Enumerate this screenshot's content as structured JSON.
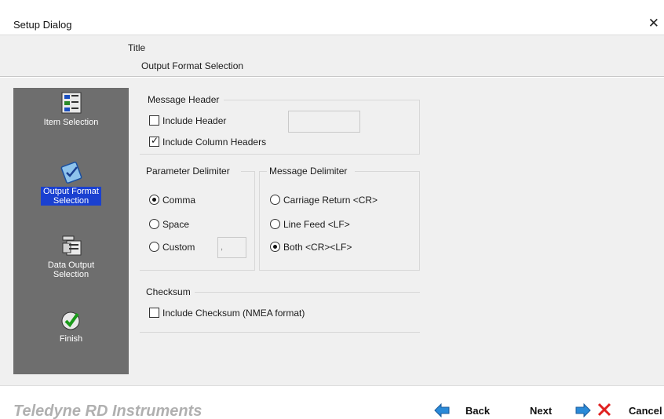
{
  "window": {
    "title": "Setup Dialog",
    "close_glyph": "✕"
  },
  "header": {
    "title": "Title",
    "subtitle": "Output Format Selection"
  },
  "sidebar": {
    "items": [
      {
        "label": "Item Selection",
        "icon": "item-selection-icon",
        "active": false
      },
      {
        "label": "Output Format\nSelection",
        "icon": "output-format-icon",
        "active": true
      },
      {
        "label": "Data Output\nSelection",
        "icon": "data-output-icon",
        "active": false
      },
      {
        "label": "Finish",
        "icon": "finish-icon",
        "active": false
      }
    ]
  },
  "message_header": {
    "legend": "Message Header",
    "include_header": {
      "label": "Include Header",
      "checked": false
    },
    "include_column_headers": {
      "label": "Include Column Headers",
      "checked": true
    },
    "header_text": ""
  },
  "parameter_delimiter": {
    "legend": "Parameter Delimiter",
    "options": [
      {
        "label": "Comma",
        "checked": true
      },
      {
        "label": "Space",
        "checked": false
      },
      {
        "label": "Custom",
        "checked": false
      }
    ],
    "custom_value": ","
  },
  "message_delimiter": {
    "legend": "Message Delimiter",
    "options": [
      {
        "label": "Carriage Return <CR>",
        "checked": false
      },
      {
        "label": "Line Feed <LF>",
        "checked": false
      },
      {
        "label": "Both <CR><LF>",
        "checked": true
      }
    ]
  },
  "checksum": {
    "legend": "Checksum",
    "include": {
      "label": "Include Checksum (NMEA format)",
      "checked": false
    }
  },
  "footer": {
    "brand": "Teledyne RD Instruments",
    "back_label": "Back",
    "next_label": "Next",
    "cancel_label": "Cancel"
  },
  "colors": {
    "sidebar_bg": "#6e6e6e",
    "active_highlight": "#1a40d0",
    "arrow_blue": "#2a8ad8",
    "cancel_red": "#e02020"
  }
}
